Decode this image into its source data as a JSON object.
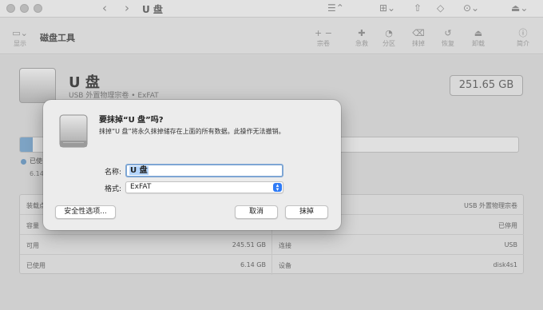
{
  "window": {
    "title": "U 盘"
  },
  "toolbar": {
    "sidebar_label": "显示",
    "title": "磁盘工具",
    "add_symbol": "+",
    "remove_symbol": "−",
    "items": [
      {
        "label": "宗卷"
      },
      {
        "label": "急救"
      },
      {
        "label": "分区"
      },
      {
        "label": "抹掉"
      },
      {
        "label": "恢复"
      },
      {
        "label": "卸载"
      },
      {
        "label": "简介"
      }
    ]
  },
  "disk": {
    "name": "U 盘",
    "subtitle": "USB 外置物理宗卷 • ExFAT",
    "size": "251.65 GB",
    "used_fraction": 0.025,
    "used_label": "已使",
    "used_value": "6.14"
  },
  "info": {
    "left": [
      {
        "key": "装载点",
        "value": ""
      },
      {
        "key": "容量",
        "value": ""
      },
      {
        "key": "可用",
        "value": "245.51 GB"
      },
      {
        "key": "已使用",
        "value": "6.14 GB"
      }
    ],
    "right": [
      {
        "key": "",
        "value": "USB 外置物理宗卷"
      },
      {
        "key": "",
        "value": "已停用"
      },
      {
        "key": "连接",
        "value": "USB"
      },
      {
        "key": "设备",
        "value": "disk4s1"
      }
    ]
  },
  "dialog": {
    "title": "要抹掉“U 盘”吗?",
    "message": "抹掉“U 盘”将永久抹掉储存在上面的所有数据。此操作无法撤销。",
    "name_label": "名称:",
    "name_value": "U 盘",
    "format_label": "格式:",
    "format_value": "ExFAT",
    "security_button": "安全性选项...",
    "cancel_button": "取消",
    "erase_button": "抹掉"
  },
  "colors": {
    "accent": "#2f7bf6",
    "selection": "#b3d4fb",
    "focus_ring": "#7ea6d4"
  }
}
